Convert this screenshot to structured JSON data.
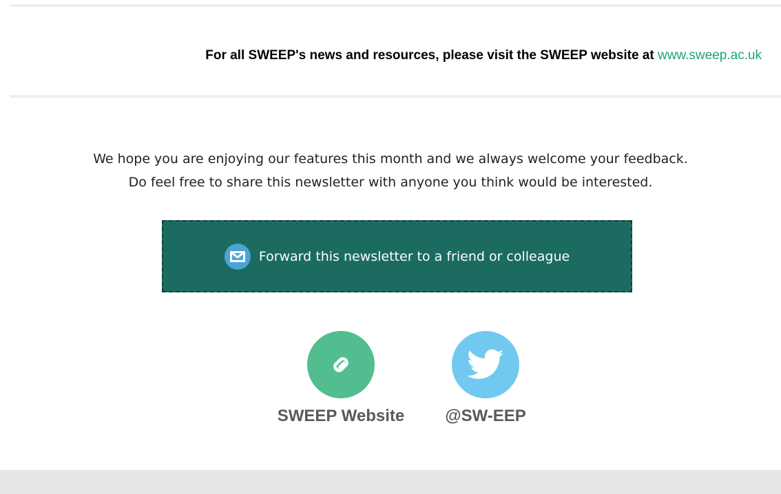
{
  "visit_banner": {
    "text": "For all SWEEP's news and resources, please visit the SWEEP website at",
    "link_text": "www.sweep.ac.uk",
    "link_color": "#1ba37a"
  },
  "message": {
    "line1": "We hope you are enjoying our features this month and we always welcome your feedback.",
    "line2": "Do feel free to share this newsletter with anyone you think would be interested."
  },
  "forward_button": {
    "label": "Forward this newsletter to a friend or colleague",
    "icon": "mail-icon",
    "background": "#1b6b61"
  },
  "social_links": [
    {
      "label": "SWEEP Website",
      "icon": "link-icon",
      "color": "#52bd8f"
    },
    {
      "label": "@SW-EEP",
      "icon": "twitter-icon",
      "color": "#72c9ef"
    }
  ]
}
